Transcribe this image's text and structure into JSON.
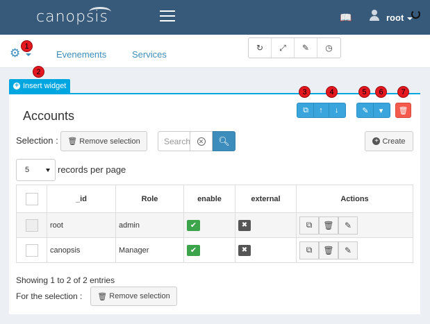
{
  "navbar": {
    "logo": "canopsis",
    "user_name": "root"
  },
  "subbar": {
    "links": [
      "Evenements",
      "Services"
    ],
    "badges": [
      "1",
      "2",
      "3",
      "4",
      "5",
      "6",
      "7"
    ]
  },
  "insert_widget_label": "Insert widget",
  "panel": {
    "title": "Accounts",
    "selection_label": "Selection :",
    "remove_selection": "Remove selection",
    "search_placeholder": "Search",
    "create_label": "Create",
    "records_per_page_value": "5",
    "records_per_page_label": "records per page"
  },
  "table": {
    "headers": [
      "",
      "_id",
      "Role",
      "enable",
      "external",
      "Actions"
    ],
    "rows": [
      {
        "id": "root",
        "role": "admin"
      },
      {
        "id": "canopsis",
        "role": "Manager"
      }
    ]
  },
  "footer": {
    "showing": "Showing 1 to 2 of 2 entries",
    "for_selection": "For the selection :",
    "remove_selection": "Remove selection"
  },
  "colors": {
    "accent": "#00a6e0",
    "navbar": "#375a7a",
    "badge": "#e4181e",
    "danger": "#f55b4d",
    "success": "#3ca44a"
  }
}
